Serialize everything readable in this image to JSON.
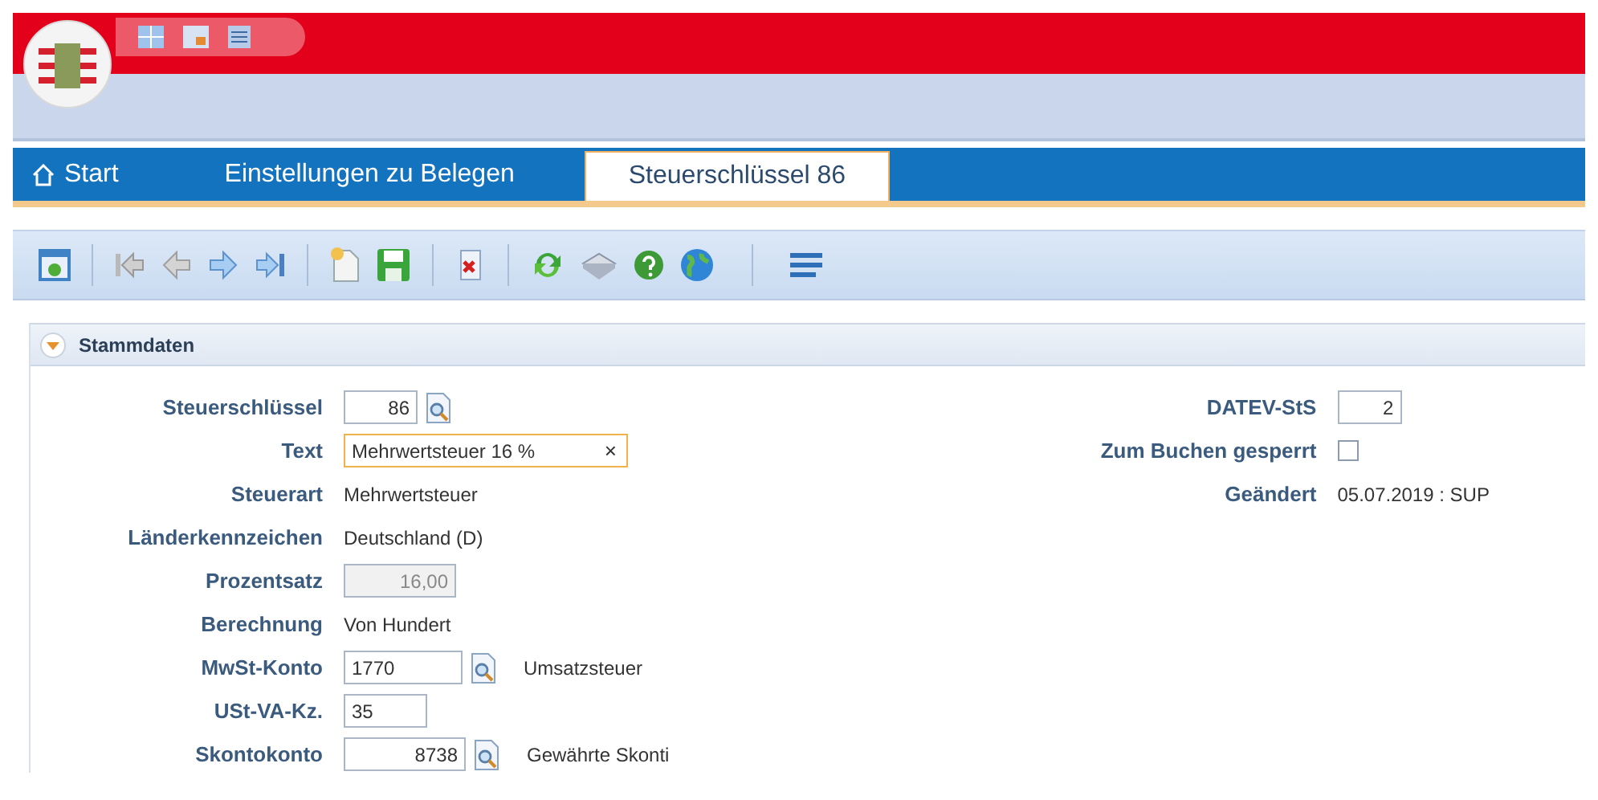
{
  "tabs": [
    {
      "label": "Start",
      "kind": "home",
      "selected": false
    },
    {
      "label": "Einstellungen zu Belegen",
      "kind": "plain",
      "selected": false
    },
    {
      "label": "Steuerschlüssel 86",
      "kind": "plain",
      "selected": true
    }
  ],
  "section": {
    "title": "Stammdaten",
    "expanded": true
  },
  "fields": [
    {
      "label": "Steuerschlüssel",
      "kind": "input",
      "value": "86",
      "lookup": true
    },
    {
      "label": "Text",
      "kind": "input",
      "value": "Mehrwertsteuer 16 %",
      "focused": true,
      "clear_icon": "×"
    },
    {
      "label": "Steuerart",
      "kind": "static",
      "value": "Mehrwertsteuer"
    },
    {
      "label": "Länderkennzeichen",
      "kind": "static",
      "value": "Deutschland (D)"
    },
    {
      "label": "Prozentsatz",
      "kind": "input",
      "value": "16,00",
      "disabled": true
    },
    {
      "label": "Berechnung",
      "kind": "static",
      "value": "Von Hundert"
    },
    {
      "label": "MwSt-Konto",
      "kind": "input",
      "value": "1770",
      "lookup": true,
      "note": "Umsatzsteuer"
    },
    {
      "label": "USt-VA-Kz.",
      "kind": "input",
      "value": "35"
    },
    {
      "label": "Skontokonto",
      "kind": "input",
      "value": "8738",
      "lookup": true,
      "note": "Gewährte Skonti"
    }
  ],
  "side_fields": [
    {
      "label": "DATEV-StS",
      "kind": "input",
      "value": "2"
    },
    {
      "label": "Zum Buchen gesperrt",
      "kind": "checkbox",
      "checked": false
    },
    {
      "label": "Geändert",
      "kind": "static",
      "value": "05.07.2019 : SUP"
    }
  ]
}
